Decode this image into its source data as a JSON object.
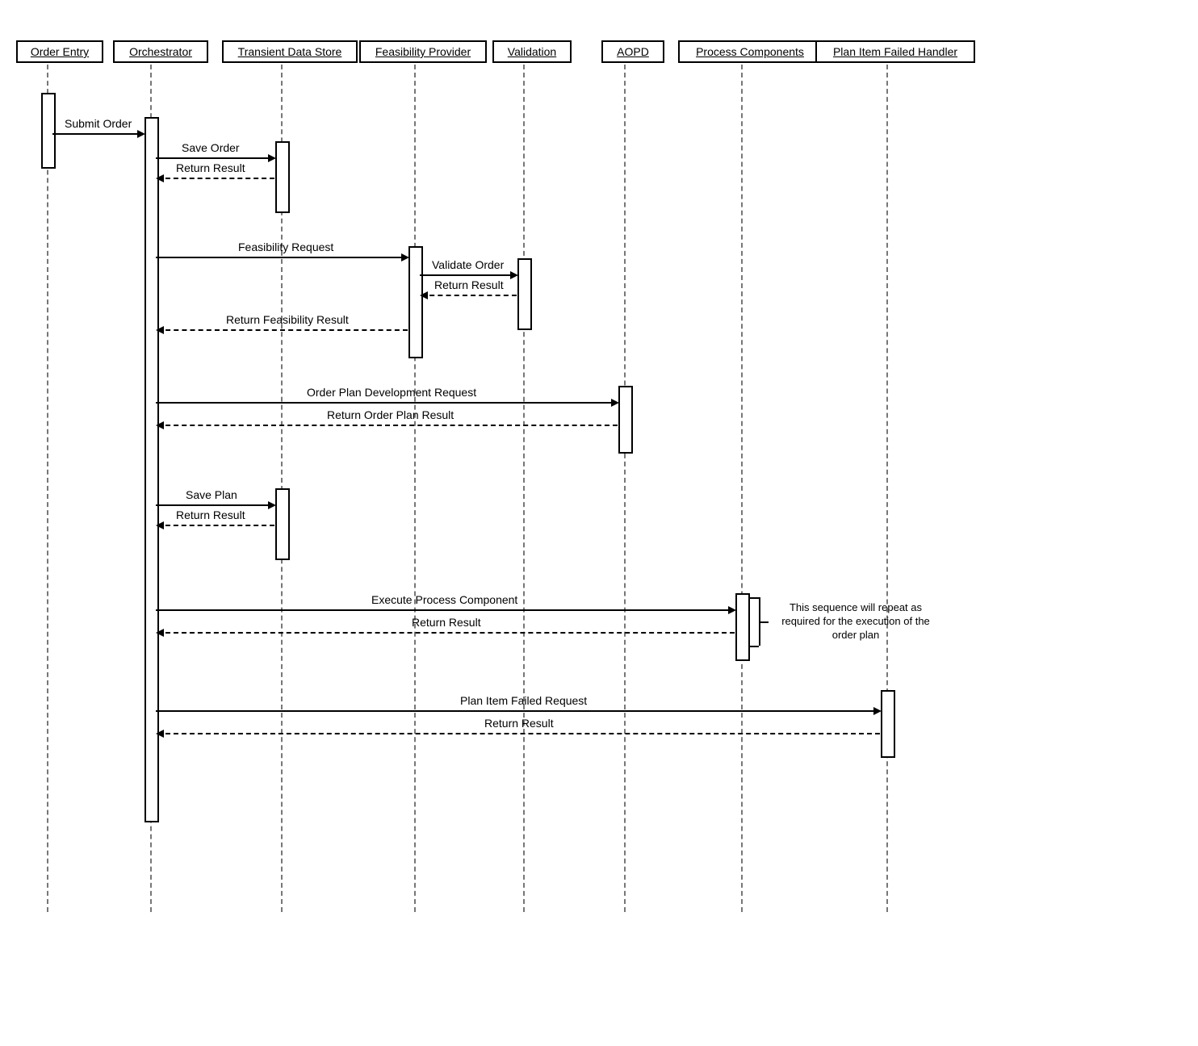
{
  "chart_data": {
    "type": "sequence-diagram",
    "participants": [
      "Order Entry",
      "Orchestrator",
      "Transient Data Store",
      "Feasibility Provider",
      "Validation",
      "AOPD",
      "Process Components",
      "Plan Item Failed Handler"
    ],
    "messages": [
      {
        "from": "Order Entry",
        "to": "Orchestrator",
        "label": "Submit Order",
        "return": false
      },
      {
        "from": "Orchestrator",
        "to": "Transient Data Store",
        "label": "Save Order",
        "return": false
      },
      {
        "from": "Transient Data Store",
        "to": "Orchestrator",
        "label": "Return Result",
        "return": true
      },
      {
        "from": "Orchestrator",
        "to": "Feasibility Provider",
        "label": "Feasibility Request",
        "return": false
      },
      {
        "from": "Feasibility Provider",
        "to": "Validation",
        "label": "Validate Order",
        "return": false
      },
      {
        "from": "Validation",
        "to": "Feasibility Provider",
        "label": "Return Result",
        "return": true
      },
      {
        "from": "Feasibility Provider",
        "to": "Orchestrator",
        "label": "Return Feasibility Result",
        "return": true
      },
      {
        "from": "Orchestrator",
        "to": "AOPD",
        "label": "Order Plan Development Request",
        "return": false
      },
      {
        "from": "AOPD",
        "to": "Orchestrator",
        "label": "Return Order Plan Result",
        "return": true
      },
      {
        "from": "Orchestrator",
        "to": "Transient Data Store",
        "label": "Save Plan",
        "return": false
      },
      {
        "from": "Transient Data Store",
        "to": "Orchestrator",
        "label": "Return Result",
        "return": true
      },
      {
        "from": "Orchestrator",
        "to": "Process Components",
        "label": "Execute Process Component",
        "return": false
      },
      {
        "from": "Process Components",
        "to": "Orchestrator",
        "label": "Return Result",
        "return": true
      },
      {
        "from": "Orchestrator",
        "to": "Plan Item Failed Handler",
        "label": "Plan Item Failed Request",
        "return": false
      },
      {
        "from": "Plan Item Failed Handler",
        "to": "Orchestrator",
        "label": "Return Result",
        "return": true
      }
    ],
    "note": "This sequence will repeat as required for the execution of the order plan"
  },
  "p": {
    "orderEntry": "Order Entry",
    "orchestrator": "Orchestrator",
    "tds": "Transient Data Store",
    "feasibility": "Feasibility Provider",
    "validation": "Validation",
    "aopd": "AOPD",
    "process": "Process Components",
    "planFailed": "Plan Item Failed Handler"
  },
  "m": {
    "submitOrder": "Submit Order",
    "saveOrder": "Save Order",
    "returnResult": "Return Result",
    "feasibilityReq": "Feasibility Request",
    "validateOrder": "Validate Order",
    "returnFeasibility": "Return Feasibility Result",
    "opdReq": "Order Plan Development Request",
    "returnOpd": "Return Order Plan Result",
    "savePlan": "Save Plan",
    "execProcess": "Execute Process Component",
    "planFailedReq": "Plan Item Failed Request"
  },
  "note": "This sequence will repeat as required for the execution of the order plan"
}
